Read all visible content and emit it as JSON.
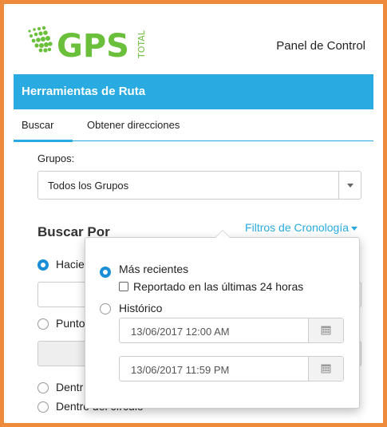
{
  "header": {
    "logo_text": "GPS",
    "logo_sub": "TOTAL",
    "panel_link": "Panel de Control"
  },
  "titlebar": {
    "title": "Herramientas de Ruta"
  },
  "tabs": [
    {
      "label": "Buscar",
      "active": true
    },
    {
      "label": "Obtener direcciones",
      "active": false
    }
  ],
  "grupos": {
    "label": "Grupos:",
    "selected": "Todos los Grupos"
  },
  "buscar_por": {
    "title": "Buscar Por",
    "filters_link": "Filtros de Cronología",
    "options": [
      "Hacie",
      "Punto",
      "Dentr",
      "Dentro del círculo"
    ]
  },
  "popup": {
    "recent_label": "Más recientes",
    "last24_label": "Reportado en las últimas 24 horas",
    "historic_label": "Histórico",
    "start_date": "13/06/2017 12:00 AM",
    "end_date": "13/06/2017 11:59 PM"
  },
  "colors": {
    "accent": "#29abe2",
    "frame": "#ee8a3c",
    "logo_green": "#6abf3b",
    "radio_on": "#1a8fd8"
  }
}
